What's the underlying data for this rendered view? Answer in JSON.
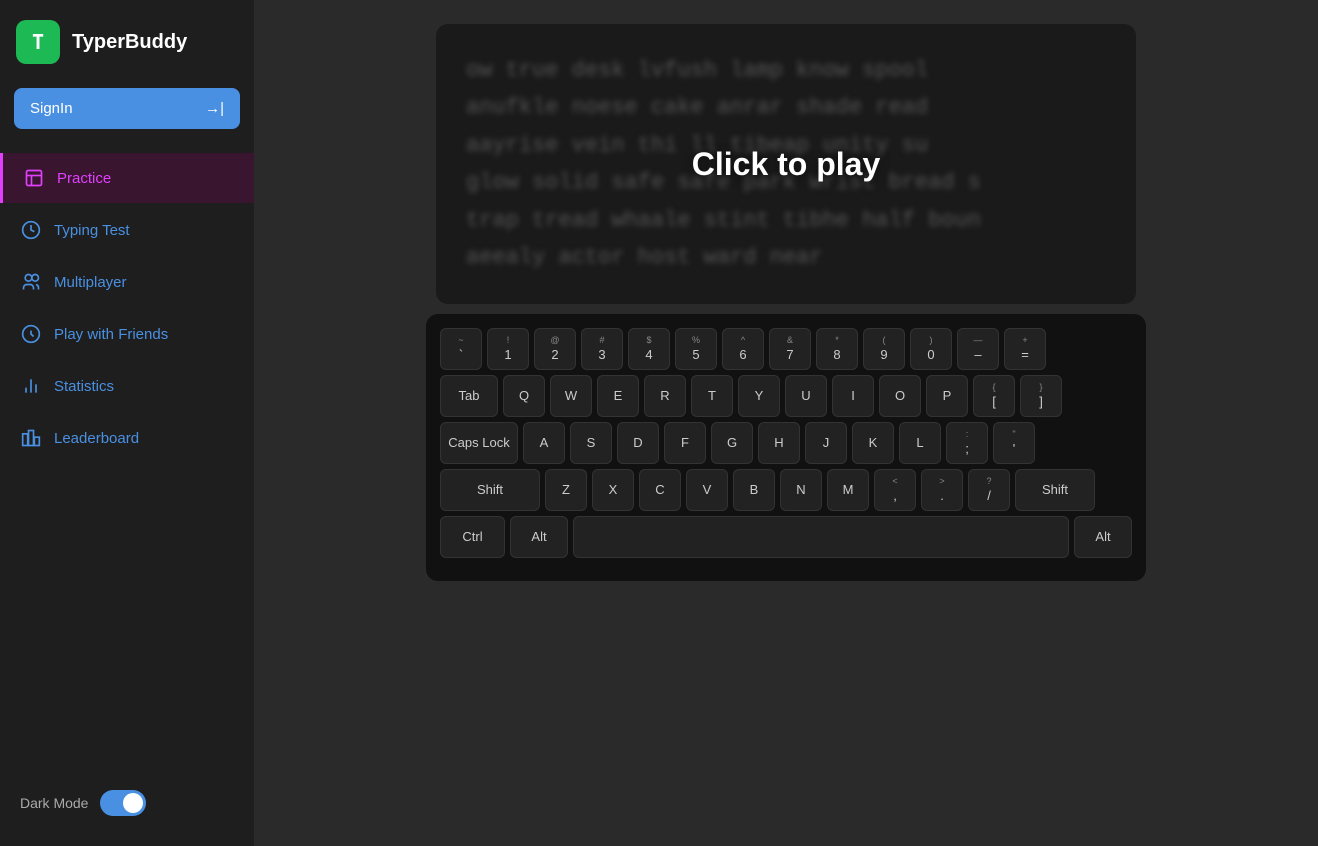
{
  "app": {
    "name": "TyperBuddy",
    "logo_letter": "T"
  },
  "sidebar": {
    "signin_label": "SignIn",
    "signin_arrow": "→|",
    "nav_items": [
      {
        "id": "practice",
        "label": "Practice",
        "active": true
      },
      {
        "id": "typing-test",
        "label": "Typing Test",
        "active": false
      },
      {
        "id": "multiplayer",
        "label": "Multiplayer",
        "active": false
      },
      {
        "id": "play-with-friends",
        "label": "Play with Friends",
        "active": false
      },
      {
        "id": "statistics",
        "label": "Statistics",
        "active": false
      },
      {
        "id": "leaderboard",
        "label": "Leaderboard",
        "active": false
      }
    ],
    "dark_mode_label": "Dark Mode"
  },
  "main": {
    "click_to_play": "Click to play",
    "typing_text_line1": "ow true desk lvfush lamp know spool",
    "typing_text_line2": "anufkle noese cake anrar shade read",
    "typing_text_line3": "aayrise vein thi   ll tibeap unity su",
    "typing_text_line4": "glow solid safe safe park wrist bread s",
    "typing_text_line5": "trap tread whaale stint tibhe half boun",
    "typing_text_line6": "aeealy actor host ward near"
  },
  "keyboard": {
    "rows": [
      [
        {
          "top": "~",
          "bot": "`"
        },
        {
          "top": "!",
          "bot": "1"
        },
        {
          "top": "@",
          "bot": "2"
        },
        {
          "top": "#",
          "bot": "3"
        },
        {
          "top": "$",
          "bot": "4"
        },
        {
          "top": "%",
          "bot": "5"
        },
        {
          "top": "^",
          "bot": "6"
        },
        {
          "top": "&",
          "bot": "7"
        },
        {
          "top": "*",
          "bot": "8"
        },
        {
          "top": "(",
          "bot": "9"
        },
        {
          "top": ")",
          "bot": "0"
        },
        {
          "top": "—",
          "bot": "–"
        },
        {
          "top": "+",
          "bot": "="
        }
      ],
      [
        {
          "label": "Tab",
          "wide": "wide-15"
        },
        {
          "label": "Q"
        },
        {
          "label": "W"
        },
        {
          "label": "E"
        },
        {
          "label": "R"
        },
        {
          "label": "T"
        },
        {
          "label": "Y"
        },
        {
          "label": "U"
        },
        {
          "label": "I"
        },
        {
          "label": "O"
        },
        {
          "label": "P"
        },
        {
          "top": "{",
          "bot": "["
        },
        {
          "top": "}",
          "bot": "]"
        }
      ],
      [
        {
          "label": "Caps Lock",
          "wide": "wide-caps"
        },
        {
          "label": "A"
        },
        {
          "label": "S"
        },
        {
          "label": "D"
        },
        {
          "label": "F"
        },
        {
          "label": "G"
        },
        {
          "label": "H"
        },
        {
          "label": "J"
        },
        {
          "label": "K"
        },
        {
          "label": "L"
        },
        {
          "top": ":",
          "bot": ";"
        },
        {
          "top": "\"",
          "bot": "'"
        }
      ],
      [
        {
          "label": "Shift",
          "wide": "wide-shift-l"
        },
        {
          "label": "Z"
        },
        {
          "label": "X"
        },
        {
          "label": "C"
        },
        {
          "label": "V"
        },
        {
          "label": "B"
        },
        {
          "label": "N"
        },
        {
          "label": "M"
        },
        {
          "top": "<",
          "bot": ","
        },
        {
          "top": ">",
          "bot": "."
        },
        {
          "top": "?",
          "bot": "/"
        },
        {
          "label": "Shift",
          "wide": "wide-shift-r"
        }
      ],
      [
        {
          "label": "Ctrl",
          "wide": "wide-ctrl"
        },
        {
          "label": "Alt",
          "wide": "wide-alt"
        },
        {
          "label": "",
          "wide": "spacebar"
        },
        {
          "label": "Alt",
          "wide": "wide-alt"
        }
      ]
    ]
  },
  "colors": {
    "active_nav_bg": "#3a1530",
    "active_nav_text": "#e040fb",
    "active_nav_border": "#e040fb",
    "signin_bg": "#4a90e2",
    "logo_bg": "#1db954",
    "nav_text": "#4a90e2",
    "toggle_bg": "#4a90e2"
  }
}
